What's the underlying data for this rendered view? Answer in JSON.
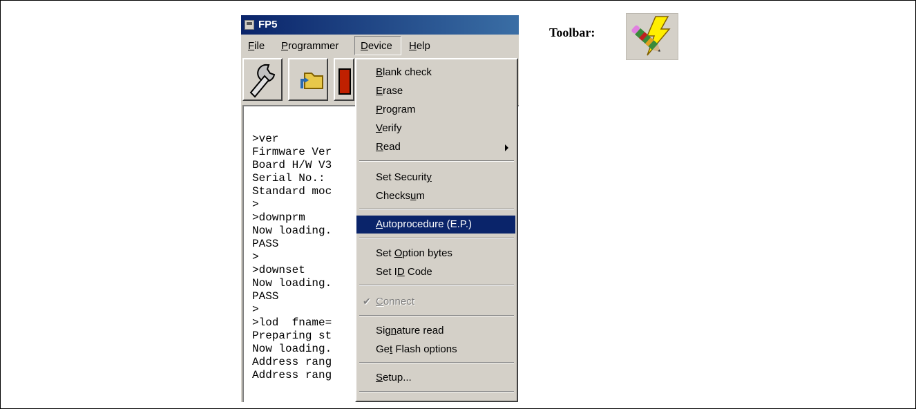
{
  "window": {
    "title": "FP5"
  },
  "menubar": {
    "items": [
      {
        "label": "File"
      },
      {
        "label": "Programmer"
      },
      {
        "label": "Device"
      },
      {
        "label": "Help"
      }
    ]
  },
  "toolbar": {
    "buttons": [
      {
        "icon": "wrench-icon"
      },
      {
        "icon": "open-folder-icon"
      },
      {
        "icon": "device-icon"
      }
    ]
  },
  "console": {
    "lines": [
      ">ver",
      "Firmware Ver",
      "Board H/W V3",
      "Serial No.:",
      "Standard moc",
      ">",
      ">downprm",
      "Now loading.",
      "PASS",
      ">",
      ">downset",
      "Now loading.",
      "PASS",
      ">",
      ">lod  fname=",
      "Preparing st",
      "Now loading.",
      "Address rang",
      "Address rang"
    ]
  },
  "device_menu": {
    "items": [
      {
        "label": "Blank check"
      },
      {
        "label": "Erase"
      },
      {
        "label": "Program"
      },
      {
        "label": "Verify"
      },
      {
        "label": "Read",
        "submenu": true
      },
      {
        "label": "Set Security"
      },
      {
        "label": "Checksum"
      },
      {
        "label": "Autoprocedure (E.P.)",
        "highlighted": true
      },
      {
        "label": "Set Option bytes"
      },
      {
        "label": "Set ID Code"
      },
      {
        "label": "Connect",
        "disabled": true,
        "checked": true
      },
      {
        "label": "Signature read"
      },
      {
        "label": "Get Flash options"
      },
      {
        "label": "Setup..."
      }
    ]
  },
  "annotation": {
    "label": "Toolbar:",
    "icon": "autoprocedure-lightning-pencil-icon"
  },
  "colors": {
    "titlebar": "#0a246a",
    "highlight": "#0a246a",
    "face": "#d4d0c8"
  }
}
